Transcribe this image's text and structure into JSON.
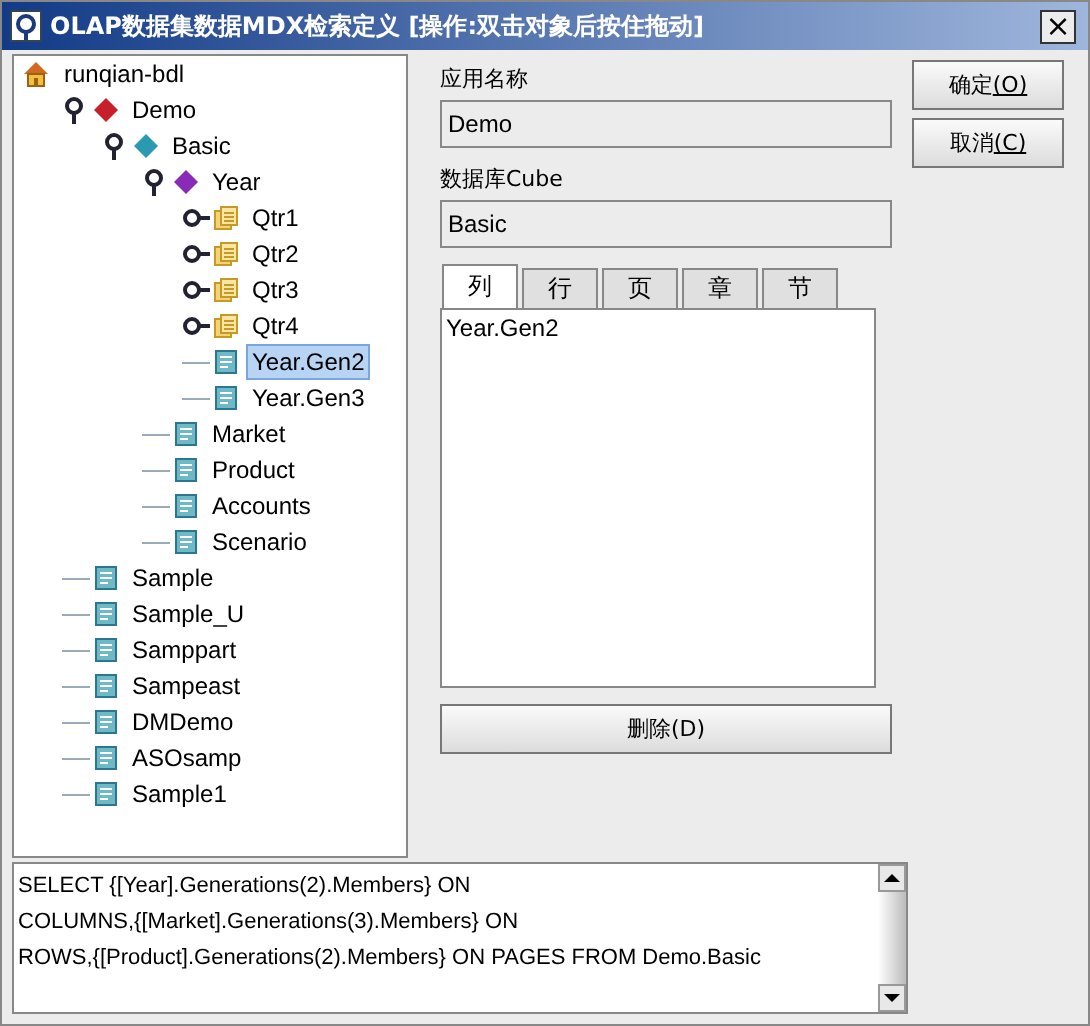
{
  "window": {
    "title": "OLAP数据集数据MDX检索定义 [操作:双击对象后按住拖动]",
    "close": "×"
  },
  "tree": [
    {
      "label": "runqian-bdl",
      "kind": "server",
      "selected": false,
      "children": [
        {
          "label": "Demo",
          "kind": "app",
          "selected": false,
          "expanded": true,
          "children": [
            {
              "label": "Basic",
              "kind": "database",
              "selected": false,
              "expanded": true,
              "children": [
                {
                  "label": "Year",
                  "kind": "dimension",
                  "selected": false,
                  "expanded": true,
                  "children": [
                    {
                      "label": "Qtr1",
                      "kind": "member",
                      "selected": false,
                      "expanded": false
                    },
                    {
                      "label": "Qtr2",
                      "kind": "member",
                      "selected": false,
                      "expanded": false
                    },
                    {
                      "label": "Qtr3",
                      "kind": "member",
                      "selected": false,
                      "expanded": false
                    },
                    {
                      "label": "Qtr4",
                      "kind": "member",
                      "selected": false,
                      "expanded": false
                    },
                    {
                      "label": "Year.Gen2",
                      "kind": "level",
                      "selected": true
                    },
                    {
                      "label": "Year.Gen3",
                      "kind": "level",
                      "selected": false
                    }
                  ]
                },
                {
                  "label": "Market",
                  "kind": "level",
                  "selected": false
                },
                {
                  "label": "Product",
                  "kind": "level",
                  "selected": false
                },
                {
                  "label": "Accounts",
                  "kind": "level",
                  "selected": false
                },
                {
                  "label": "Scenario",
                  "kind": "level",
                  "selected": false
                }
              ]
            }
          ]
        },
        {
          "label": "Sample",
          "kind": "level",
          "selected": false
        },
        {
          "label": "Sample_U",
          "kind": "level",
          "selected": false
        },
        {
          "label": "Samppart",
          "kind": "level",
          "selected": false
        },
        {
          "label": "Sampeast",
          "kind": "level",
          "selected": false
        },
        {
          "label": "DMDemo",
          "kind": "level",
          "selected": false
        },
        {
          "label": "ASOsamp",
          "kind": "level",
          "selected": false
        },
        {
          "label": "Sample1",
          "kind": "level",
          "selected": false
        }
      ]
    }
  ],
  "app_name": {
    "label": "应用名称",
    "value": "Demo"
  },
  "cube": {
    "label": "数据库Cube",
    "value": "Basic"
  },
  "tabs": [
    {
      "label": "列",
      "selected": true
    },
    {
      "label": "行",
      "selected": false
    },
    {
      "label": "页",
      "selected": false
    },
    {
      "label": "章",
      "selected": false
    },
    {
      "label": "节",
      "selected": false
    }
  ],
  "tab_items": [
    "Year.Gen2"
  ],
  "delete_button": "删除(D)",
  "buttons": [
    {
      "label": "确定",
      "mnemonic": "(O)"
    },
    {
      "label": "取消",
      "mnemonic": "(C)"
    }
  ],
  "query_lines": [
    "SELECT {[Year].Generations(2).Members} ON",
    "COLUMNS,{[Market].Generations(3).Members} ON",
    "ROWS,{[Product].Generations(2).Members} ON PAGES FROM Demo.Basic"
  ]
}
